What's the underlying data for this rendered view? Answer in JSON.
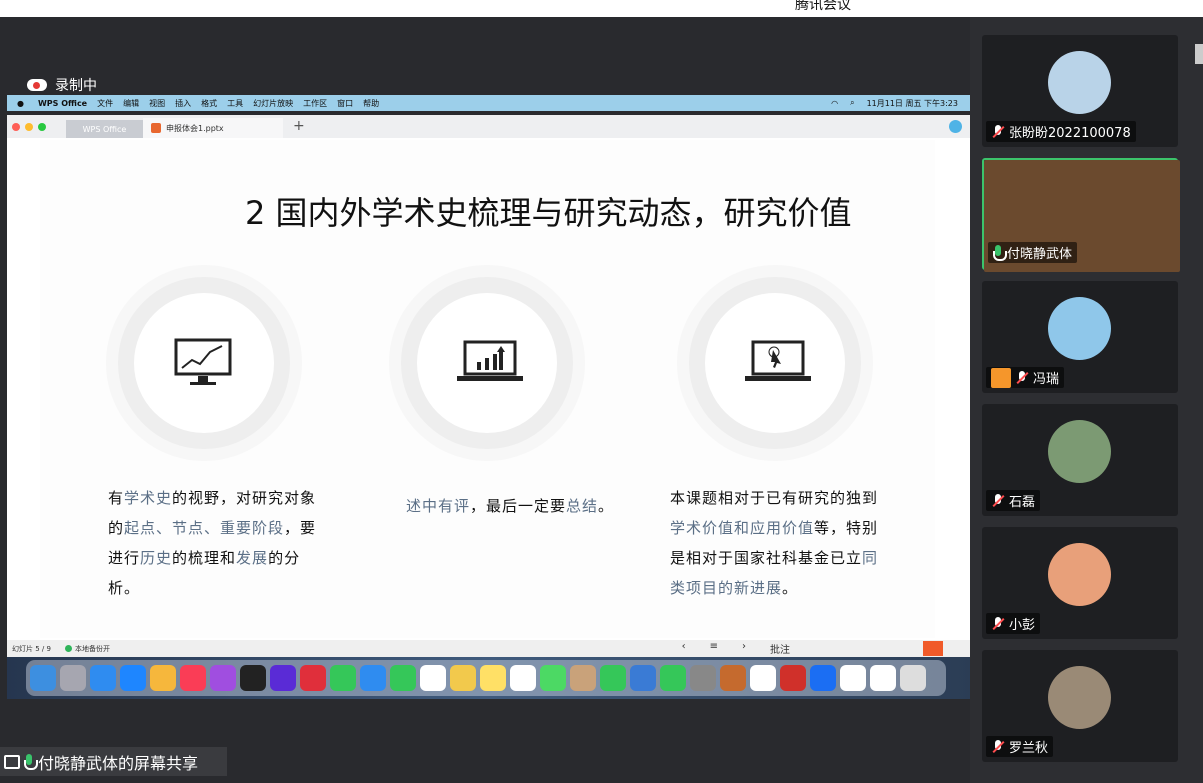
{
  "meeting": {
    "app_title": "腾讯会议",
    "recording_label": "录制中",
    "share_label": "付晓静武体的屏幕共享"
  },
  "mac_menu": {
    "app": "WPS Office",
    "items": [
      "文件",
      "编辑",
      "视图",
      "插入",
      "格式",
      "工具",
      "幻灯片放映",
      "工作区",
      "窗口",
      "帮助"
    ],
    "clock": "11月11日 周五 下午3:23"
  },
  "wps": {
    "tabs": [
      "WPS Office",
      "申报体会1.pptx"
    ],
    "status": {
      "slide_counter": "幻灯片 5 / 9",
      "backup": "本地备份开",
      "comment": "批注"
    }
  },
  "slide": {
    "title": "2 国内外学术史梳理与研究动态，研究价值",
    "col1": [
      {
        "t": "有",
        "h": false
      },
      {
        "t": "学术史",
        "h": true
      },
      {
        "t": "的视野，对研究对象的",
        "h": false
      },
      {
        "t": "起点、节点、重要阶段",
        "h": true
      },
      {
        "t": "，要进行",
        "h": false
      },
      {
        "t": "历史",
        "h": true
      },
      {
        "t": "的梳理和",
        "h": false
      },
      {
        "t": "发展",
        "h": true
      },
      {
        "t": "的分析。",
        "h": false
      }
    ],
    "col2": [
      {
        "t": "述中有评",
        "h": true
      },
      {
        "t": "，最后一定要",
        "h": false
      },
      {
        "t": "总结",
        "h": true
      },
      {
        "t": "。",
        "h": false
      }
    ],
    "col3": [
      {
        "t": "本课题相对于已有研究的独到",
        "h": false
      },
      {
        "t": "学术价值和应用价值",
        "h": true
      },
      {
        "t": "等，特别是相对于国家社科基金已立",
        "h": false
      },
      {
        "t": "同类项目的新进展",
        "h": true
      },
      {
        "t": "。",
        "h": false
      }
    ]
  },
  "participants": [
    {
      "name": "张盼盼2022100078",
      "muted": true,
      "color": "#b9d3e8"
    },
    {
      "name": "付晓静武体",
      "muted": false,
      "color": "#6b4a2e",
      "active": true
    },
    {
      "name": "冯瑞",
      "muted": true,
      "color": "#8fc7ea",
      "host": true
    },
    {
      "name": "石磊",
      "muted": true,
      "color": "#7c9a73"
    },
    {
      "name": "小彭",
      "muted": true,
      "color": "#e8a07a"
    },
    {
      "name": "罗兰秋",
      "muted": true,
      "color": "#9a8a76"
    }
  ],
  "dock_icons": [
    "finder-icon",
    "launchpad-icon",
    "safari-icon",
    "appstore-icon",
    "photos-icon",
    "music-icon",
    "podcasts-icon",
    "tv-icon",
    "siri-icon",
    "wps-icon",
    "messages-icon",
    "mail-icon",
    "wechat-icon",
    "calendar-icon",
    "notes-icon",
    "stickies-icon",
    "reminders-icon",
    "maps-icon",
    "contacts-icon",
    "facetime-icon",
    "keynote-icon",
    "numbers-icon",
    "settings-icon",
    "garageband-icon",
    "chrome-icon",
    "wps-office-icon",
    "tencent-meeting-icon",
    "preview-icon",
    "files-icon",
    "trash-icon"
  ]
}
